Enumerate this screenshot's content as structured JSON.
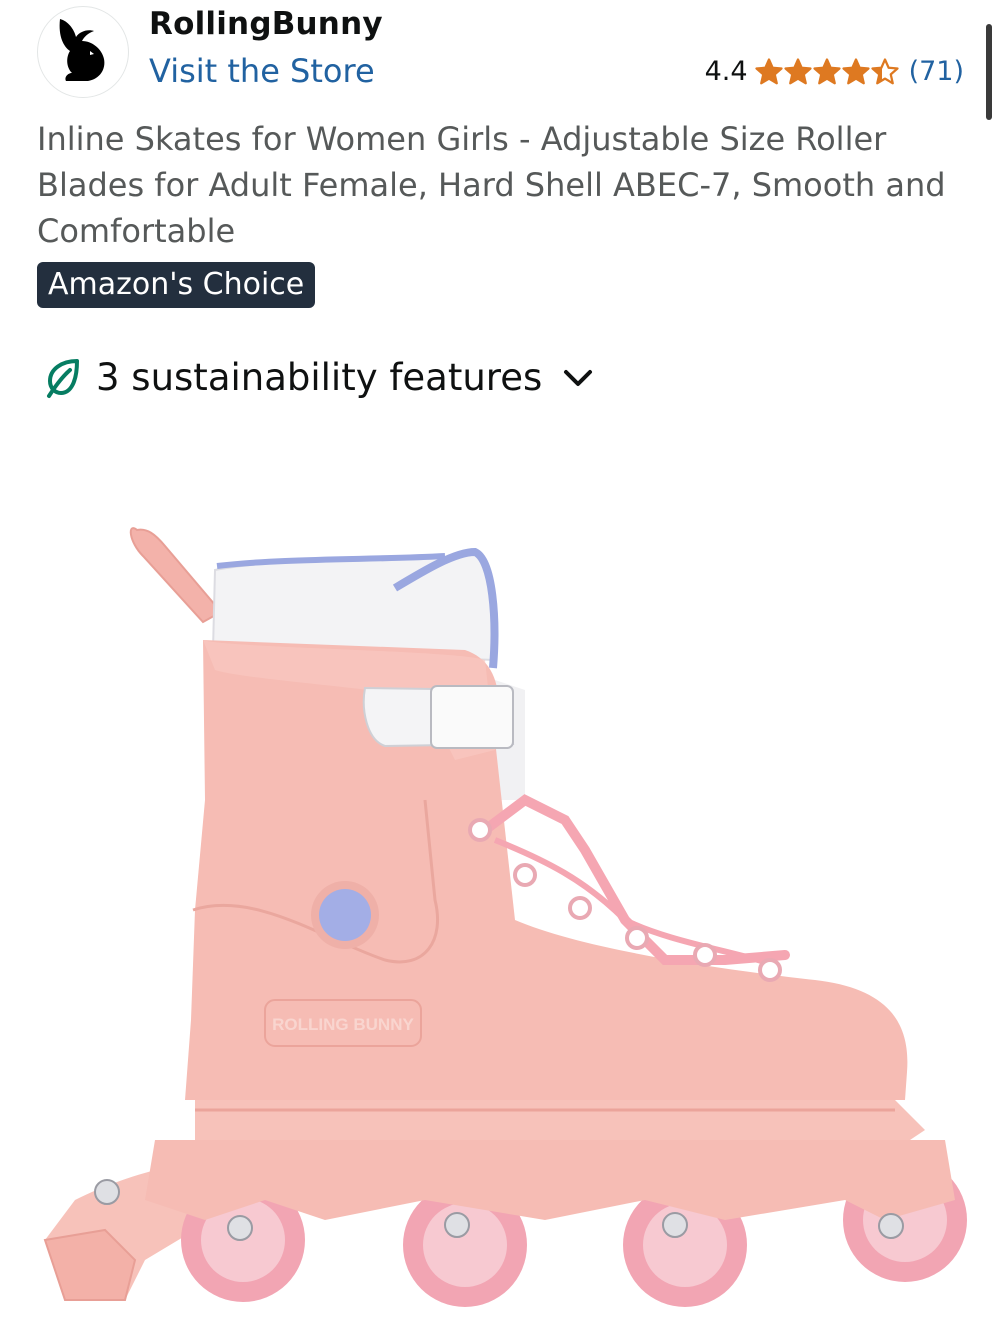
{
  "store": {
    "name": "RollingBunny",
    "visit_label": "Visit the Store",
    "logo_icon": "bunny-logo-icon"
  },
  "rating": {
    "value": "4.4",
    "stars": 4.4,
    "reviews": "(71)",
    "star_color": "#de7921"
  },
  "product": {
    "title": "Inline Skates for Women Girls - Adjustable Size Roller Blades for Adult Female, Hard Shell ABEC-7, Smooth and Comfortable",
    "badge": "Amazon's Choice",
    "image_brand_text": "ROLLING BUNNY"
  },
  "sustainability": {
    "label": "3 sustainability features",
    "icon": "leaf-icon",
    "expand_icon": "chevron-down-icon"
  },
  "colors": {
    "link": "#2162a1",
    "badge_bg": "#232f3e",
    "leaf": "#067d62",
    "skate_pink": "#f6bcb4"
  }
}
